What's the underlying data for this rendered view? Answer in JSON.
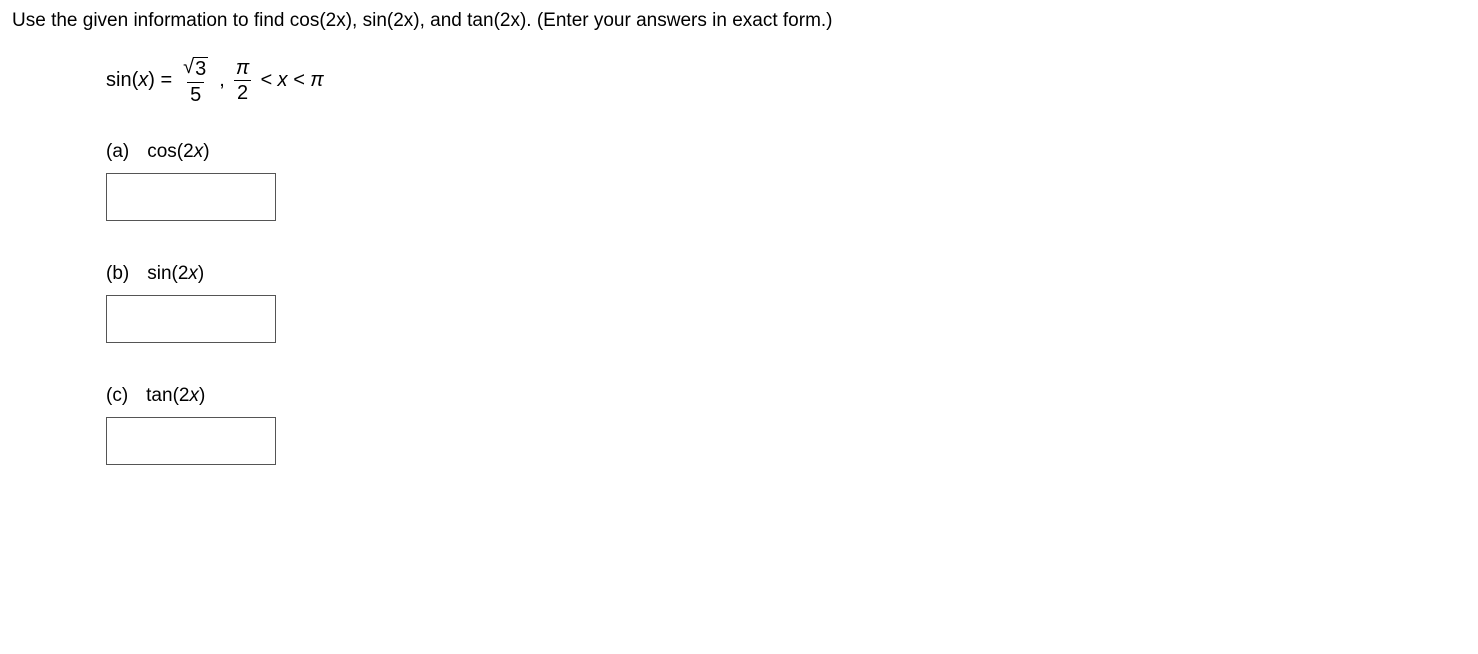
{
  "instruction": "Use the given information to find cos(2x), sin(2x), and tan(2x). (Enter your answers in exact form.)",
  "given": {
    "func": "sin(",
    "var": "x",
    "closeParen": ") =",
    "sqrt_arg": "3",
    "denom": "5",
    "comma": ",",
    "pi": "π",
    "two": "2",
    "ineq": " < x < π"
  },
  "parts": {
    "a": {
      "letter": "(a)",
      "label_pre": "cos(2",
      "label_var": "x",
      "label_post": ")"
    },
    "b": {
      "letter": "(b)",
      "label_pre": "sin(2",
      "label_var": "x",
      "label_post": ")"
    },
    "c": {
      "letter": "(c)",
      "label_pre": "tan(2",
      "label_var": "x",
      "label_post": ")"
    }
  },
  "answers": {
    "a": "",
    "b": "",
    "c": ""
  }
}
